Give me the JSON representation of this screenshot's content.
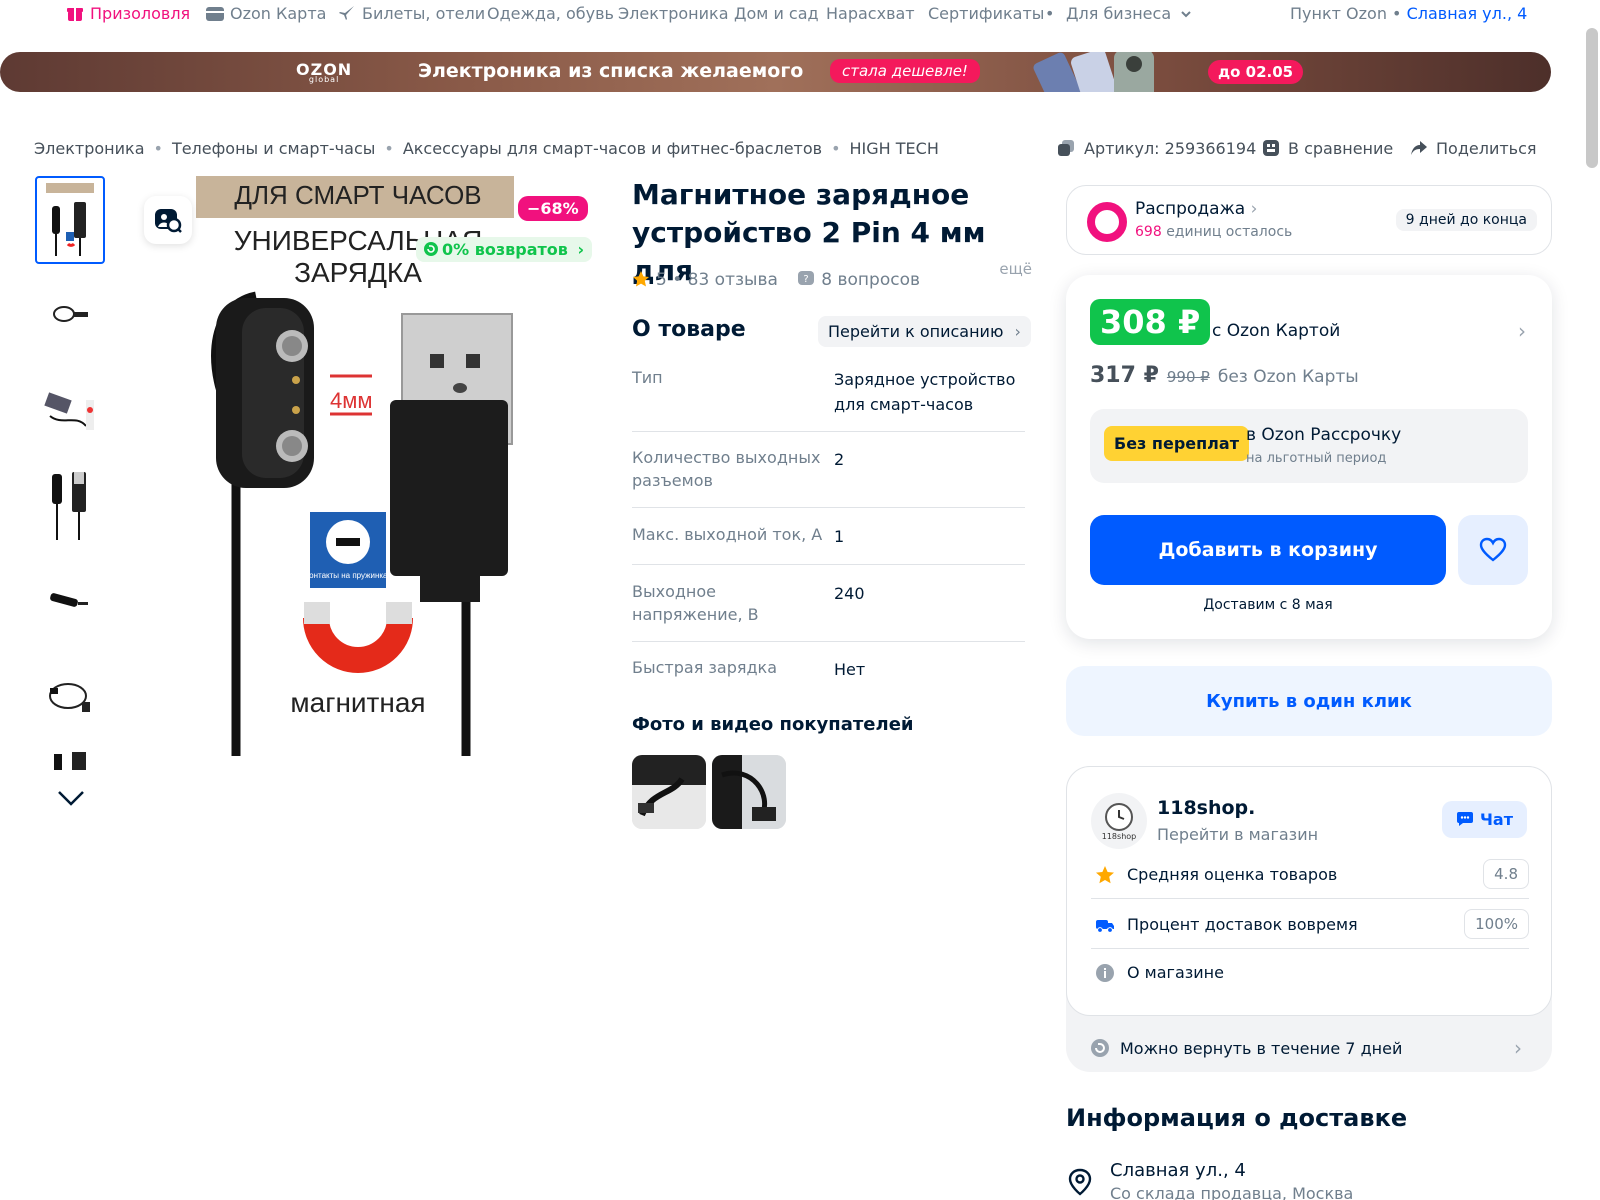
{
  "topnav": {
    "prizes": "Призоловля",
    "ozon_card": "Ozon Карта",
    "tickets": "Билеты, отели",
    "clothes": "Одежда, обувь",
    "electronics": "Электроника",
    "home": "Дом и сад",
    "hot": "Нарасхват",
    "certs": "Сертификаты",
    "business": "Для бизнеса",
    "pickup_label": "Пункт Ozon",
    "pickup_address": "Славная ул., 4"
  },
  "banner": {
    "logo": "OZON",
    "logo_sub": "global",
    "headline": "Электроника из списка желаемого",
    "pill": "стала дешевле!",
    "date": "до 02.05"
  },
  "breadcrumb": [
    "Электроника",
    "Телефоны и смарт-часы",
    "Аксессуары для смарт-часов и фитнес-браслетов",
    "HIGH TECH"
  ],
  "actions": {
    "article": "Артикул: 259366194",
    "compare": "В сравнение",
    "share": "Поделиться"
  },
  "image": {
    "discount": "−68%",
    "returns": "0% возвратов",
    "caption_top": "ДЛЯ СМАРТ ЧАСОВ",
    "caption_mid1": "УНИВЕРСАЛЬНАЯ",
    "caption_mid2": "ЗАРЯДКА",
    "size_label": "4мм",
    "contacts_label": "Контакты на пружинках",
    "magnet_label": "магнитная"
  },
  "product": {
    "title": "Магнитное зарядное устройство 2 Pin 4 мм для",
    "more": "ещё",
    "rating": "5 • 83 отзыва",
    "questions": "8 вопросов",
    "about": "О товаре",
    "to_description": "Перейти к описанию",
    "specs": [
      {
        "k": "Тип",
        "v": "Зарядное устройство для смарт-часов"
      },
      {
        "k": "Количество выходных разъемов",
        "v": "2"
      },
      {
        "k": "Макс. выходной ток, А",
        "v": "1"
      },
      {
        "k": "Выходное напряжение, В",
        "v": "240"
      },
      {
        "k": "Быстрая зарядка",
        "v": "Нет"
      }
    ],
    "photos_title": "Фото и видео покупателей"
  },
  "sale": {
    "title": "Распродажа",
    "count": "698",
    "count_label": "единиц осталось",
    "days": "9 дней до конца"
  },
  "price": {
    "card_price": "308 ₽",
    "card_label": "с Ozon Картой",
    "nocard_price": "317 ₽",
    "old_price": "990 ₽",
    "nocard_label": "без Ozon Карты",
    "installment_tag": "Без переплат",
    "installment_title": "в Ozon Рассрочку",
    "installment_sub": "на льготный период",
    "add_to_cart": "Добавить в корзину",
    "delivery_note": "Доставим с 8 мая",
    "one_click": "Купить в один клик"
  },
  "shop": {
    "logo_text": "118shop",
    "name": "118shop.",
    "link": "Перейти в магазин",
    "chat": "Чат",
    "rating_label": "Средняя оценка товаров",
    "rating_value": "4.8",
    "ontime_label": "Процент доставок вовремя",
    "ontime_value": "100%",
    "about_label": "О магазине",
    "return_label": "Можно вернуть в течение 7 дней"
  },
  "delivery": {
    "title": "Информация о доставке",
    "address": "Славная ул., 4",
    "address_sub": "Со склада продавца, Москва"
  },
  "colors": {
    "accent": "#005bff",
    "pink": "#f1117e",
    "green": "#10c44c",
    "yellow": "#ffd233"
  }
}
